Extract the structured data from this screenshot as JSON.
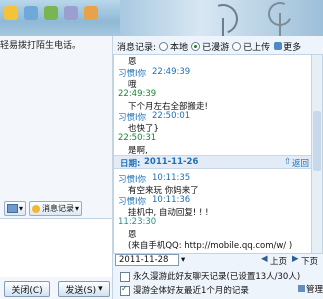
{
  "left": {
    "hint": "轻易拨打陌生电话。",
    "history_button": "消息记录",
    "close_button": "关闭(C)",
    "send_button": "发送(S)"
  },
  "record": {
    "label": "消息记录:",
    "options": [
      "本地",
      "已漫游",
      "已上传"
    ],
    "selected": "已漫游",
    "more": "更多"
  },
  "messages": [
    {
      "text": "恩",
      "style": "plain"
    },
    {
      "text": "习惯I你",
      "style": "blue"
    },
    {
      "text": "22:49:39",
      "style": "blue"
    },
    {
      "text": "哦",
      "style": "plain"
    },
    {
      "text": "22:49:39",
      "style": "green"
    },
    {
      "text": "下个月左右全部搬走!",
      "style": "plain"
    },
    {
      "text": "习惯I你",
      "style": "blue"
    },
    {
      "text": "22:50:01",
      "style": "blue"
    },
    {
      "text": "也快了}",
      "style": "plain"
    },
    {
      "text": "22:50:31",
      "style": "green"
    },
    {
      "text": "是啊,",
      "style": "plain"
    },
    {
      "text": "习惯I你",
      "style": "blue"
    },
    {
      "text": "10:11:35",
      "style": "blue"
    },
    {
      "text": "有空来玩 你妈来了",
      "style": "plain"
    },
    {
      "text": "习惯I你",
      "style": "blue"
    },
    {
      "text": "10:11:36",
      "style": "blue"
    },
    {
      "text": "挂机中, 自动回复! ! !",
      "style": "plain"
    },
    {
      "text": "11:23:30",
      "style": "green"
    },
    {
      "text": "恩",
      "style": "plain"
    },
    {
      "text": "(来自手机QQ: http://mobile.qq.com/w/ )",
      "style": "plain"
    }
  ],
  "date_divider": {
    "label": "日期:",
    "date": "2011-11-26",
    "action": "返回"
  },
  "nav": {
    "date": "2011-11-28",
    "prev": "上页",
    "next": "下页"
  },
  "options": {
    "permanent": "永久漫游此好友聊天记录(已设置13人/30人)",
    "roam_month": "漫游全体好友最近1个月的记录",
    "manage": "管理"
  }
}
